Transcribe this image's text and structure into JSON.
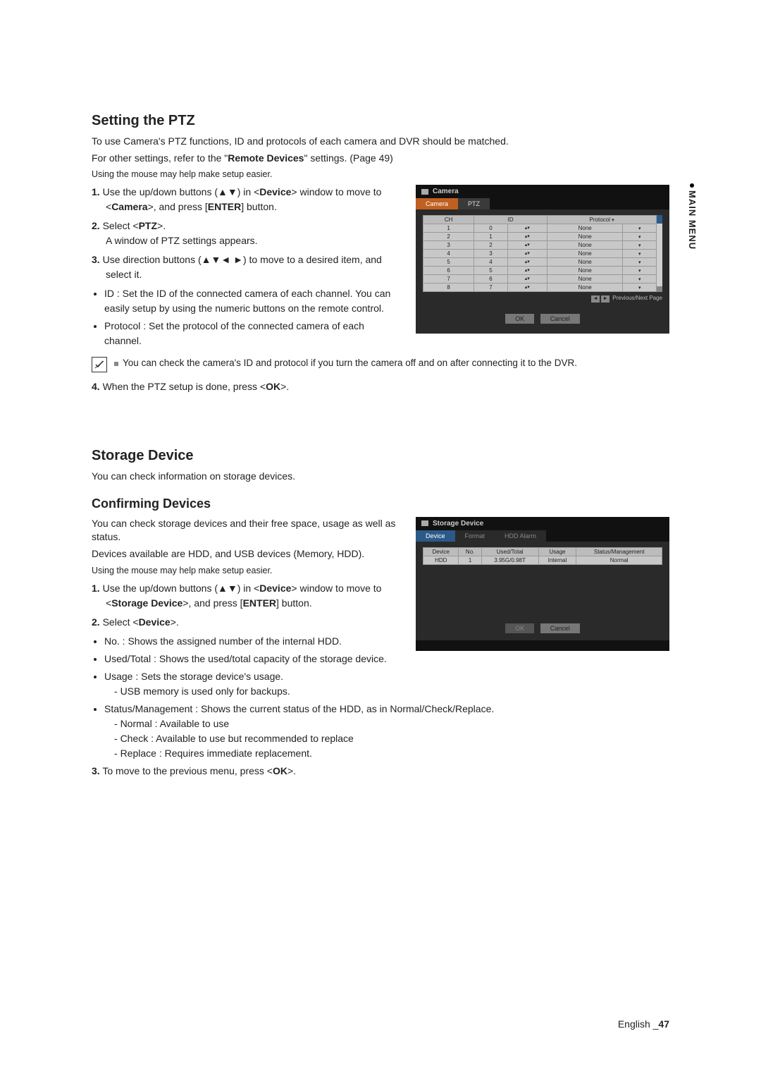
{
  "sideTab": "MAIN MENU",
  "ptz": {
    "heading": "Setting the PTZ",
    "intro1": "To use Camera's PTZ functions, ID and protocols of each camera and DVR should be matched.",
    "intro2a": "For other settings, refer to the \"",
    "intro2b": "Remote Devices",
    "intro2c": "\" settings. (Page 49)",
    "mouse": "Using the mouse may help make setup easier.",
    "step1a": "Use the up/down buttons (▲▼) in <",
    "step1b": "Device",
    "step1c": "> window to move to <",
    "step1d": "Camera",
    "step1e": ">, and press [",
    "step1f": "ENTER",
    "step1g": "] button.",
    "step2a": "Select <",
    "step2b": "PTZ",
    "step2c": ">.",
    "step2d": "A window of PTZ settings appears.",
    "step3": "Use direction buttons (▲▼◄ ►) to move to a desired item, and select it.",
    "bul_id": "ID : Set the ID of the connected camera of each channel. You can easily setup by using the numeric buttons on the remote control.",
    "bul_proto": "Protocol : Set the protocol of the connected camera of each channel.",
    "note": "You can check the camera's ID and protocol if you turn the camera off and on after connecting it to the DVR.",
    "step4a": "When the PTZ setup is done, press <",
    "step4b": "OK",
    "step4c": ">.",
    "dvr": {
      "title": "Camera",
      "tab_camera": "Camera",
      "tab_ptz": "PTZ",
      "th_ch": "CH",
      "th_id": "ID",
      "th_proto": "Protocol",
      "rows": [
        {
          "ch": "1",
          "id": "0",
          "proto": "None"
        },
        {
          "ch": "2",
          "id": "1",
          "proto": "None"
        },
        {
          "ch": "3",
          "id": "2",
          "proto": "None"
        },
        {
          "ch": "4",
          "id": "3",
          "proto": "None"
        },
        {
          "ch": "5",
          "id": "4",
          "proto": "None"
        },
        {
          "ch": "6",
          "id": "5",
          "proto": "None"
        },
        {
          "ch": "7",
          "id": "6",
          "proto": "None"
        },
        {
          "ch": "8",
          "id": "7",
          "proto": "None"
        }
      ],
      "pager": "Previous/Next Page",
      "ok": "OK",
      "cancel": "Cancel"
    }
  },
  "storage": {
    "heading": "Storage Device",
    "intro": "You can check information on storage devices.",
    "sub": "Confirming Devices",
    "p1": "You can check storage devices and their free space, usage as well as status.",
    "p2": "Devices available are HDD, and USB devices (Memory, HDD).",
    "mouse": "Using the mouse may help make setup easier.",
    "step1a": "Use the up/down buttons (▲▼) in <",
    "step1b": "Device",
    "step1c": "> window to move to <",
    "step1d": "Storage Device",
    "step1e": ">, and press [",
    "step1f": "ENTER",
    "step1g": "] button.",
    "step2a": "Select <",
    "step2b": "Device",
    "step2c": ">.",
    "bul_no": "No. : Shows the assigned number of the internal HDD.",
    "bul_used": "Used/Total : Shows the used/total capacity of the storage device.",
    "bul_usage": "Usage : Sets the storage device's usage.",
    "dash_usb": "USB memory is used only for backups.",
    "bul_status": "Status/Management : Shows the current status of the HDD, as in Normal/Check/Replace.",
    "dash_normal": "Normal : Available to use",
    "dash_check": "Check : Available to use but recommended to replace",
    "dash_replace": "Replace : Requires immediate replacement.",
    "step3a": "To move to the previous menu, press <",
    "step3b": "OK",
    "step3c": ">.",
    "dvr": {
      "title": "Storage Device",
      "tab_device": "Device",
      "tab_format": "Format",
      "tab_alarm": "HDD Alarm",
      "th_device": "Device",
      "th_no": "No.",
      "th_used": "Used/Total",
      "th_usage": "Usage",
      "th_status": "Status/Management",
      "row": {
        "device": "HDD",
        "no": "1",
        "used": "3.95G/0.98T",
        "usage": "Internal",
        "status": "Normal"
      },
      "ok": "OK",
      "cancel": "Cancel"
    }
  },
  "footer": {
    "lang": "English _",
    "page": "47"
  }
}
